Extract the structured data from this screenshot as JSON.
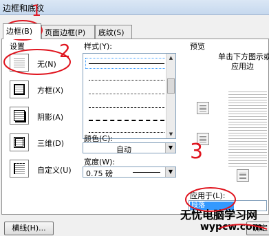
{
  "window": {
    "title": "边框和底纹"
  },
  "tabs": [
    {
      "label": "边框(B)",
      "active": true
    },
    {
      "label": "页面边框(P)",
      "active": false
    },
    {
      "label": "底纹(S)",
      "active": false
    }
  ],
  "settings": {
    "label": "设置",
    "items": [
      {
        "label": "无(N)",
        "icon": "none-border-icon"
      },
      {
        "label": "方框(X)",
        "icon": "box-border-icon"
      },
      {
        "label": "阴影(A)",
        "icon": "shadow-border-icon"
      },
      {
        "label": "三维(D)",
        "icon": "3d-border-icon"
      },
      {
        "label": "自定义(U)",
        "icon": "custom-border-icon"
      }
    ]
  },
  "style": {
    "label": "样式(Y):"
  },
  "color": {
    "label": "颜色(C):",
    "value": "自动"
  },
  "width": {
    "label": "宽度(W):",
    "value": "0.75 磅"
  },
  "preview": {
    "label": "预览",
    "hint_line1": "单击下方图示或",
    "hint_line2": "应用边"
  },
  "apply_to": {
    "label": "应用于(L):",
    "value": "段落"
  },
  "buttons": {
    "horizontal_line": "横线(H)...",
    "ok": "确定"
  },
  "annotations": {
    "mark1": "1",
    "mark2": "2",
    "mark3": "3"
  },
  "watermark": {
    "line1": "无忧电脑学习网",
    "line2": "wypcw.com"
  },
  "colors": {
    "annotation_red": "#e0141e",
    "selection_blue": "#3399ff",
    "panel_border": "#8d8d8d"
  }
}
